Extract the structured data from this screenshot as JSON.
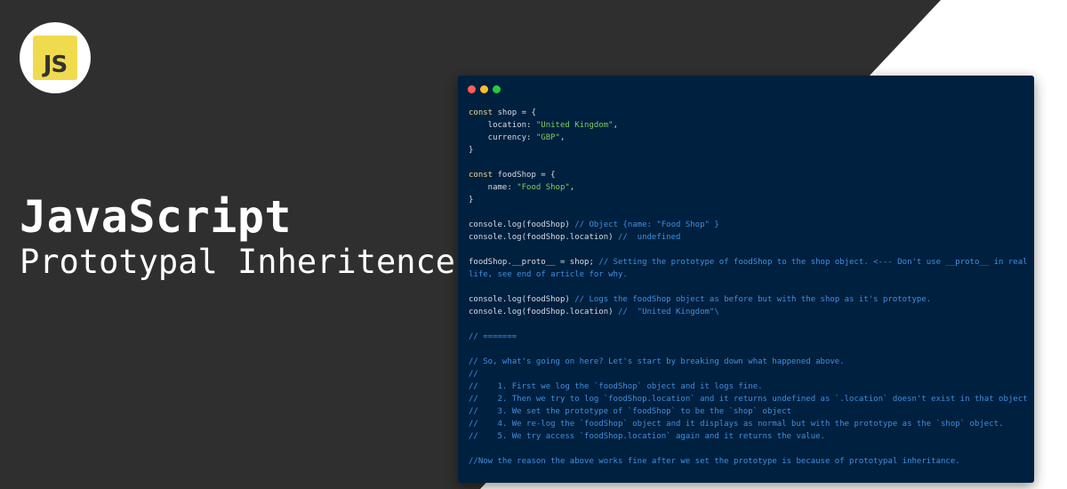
{
  "logo": {
    "text": "JS",
    "color": "#f0db4f"
  },
  "title": "JavaScript",
  "subtitle": "Prototypal Inheritence",
  "window": {
    "dot_colors": [
      "#ff5f56",
      "#ffbd2e",
      "#27c93f"
    ]
  },
  "theme": {
    "background_dark": "#2f2f2f",
    "background_light": "#ffffff",
    "code_bg": "#00203f",
    "code_text": "#d5dde6",
    "keyword": "#f0d98c",
    "string": "#7ccf5a",
    "comment": "#3f8fe0"
  },
  "code_lines": [
    [
      {
        "t": "const",
        "k": "keyword"
      },
      {
        "t": " shop = {",
        "k": "plain"
      }
    ],
    [
      {
        "t": "    location: ",
        "k": "plain"
      },
      {
        "t": "\"United Kingdom\"",
        "k": "string"
      },
      {
        "t": ",",
        "k": "plain"
      }
    ],
    [
      {
        "t": "    currency: ",
        "k": "plain"
      },
      {
        "t": "\"GBP\"",
        "k": "string"
      },
      {
        "t": ",",
        "k": "plain"
      }
    ],
    [
      {
        "t": "}",
        "k": "plain"
      }
    ],
    [],
    [
      {
        "t": "const",
        "k": "keyword"
      },
      {
        "t": " foodShop = {",
        "k": "plain"
      }
    ],
    [
      {
        "t": "    name: ",
        "k": "plain"
      },
      {
        "t": "\"Food Shop\"",
        "k": "string"
      },
      {
        "t": ",",
        "k": "plain"
      }
    ],
    [
      {
        "t": "}",
        "k": "plain"
      }
    ],
    [],
    [
      {
        "t": "console.log(foodShop) ",
        "k": "plain"
      },
      {
        "t": "// Object {name: \"Food Shop\" }",
        "k": "comment"
      }
    ],
    [
      {
        "t": "console.log(foodShop.location) ",
        "k": "plain"
      },
      {
        "t": "//  undefined",
        "k": "comment"
      }
    ],
    [],
    [
      {
        "t": "foodShop.__proto__ = shop; ",
        "k": "plain"
      },
      {
        "t": "// Setting the prototype of foodShop to the shop object. <--- Don't use __proto__ in real",
        "k": "comment"
      }
    ],
    [
      {
        "t": "life, see end of article for why.",
        "k": "comment"
      }
    ],
    [],
    [
      {
        "t": "console.log(foodShop) ",
        "k": "plain"
      },
      {
        "t": "// Logs the foodShop object as before but with the shop as it's prototype.",
        "k": "comment"
      }
    ],
    [
      {
        "t": "console.log(foodShop.location) ",
        "k": "plain"
      },
      {
        "t": "//  \"United Kingdom\"\\",
        "k": "comment"
      }
    ],
    [],
    [
      {
        "t": "// =======",
        "k": "comment"
      }
    ],
    [],
    [
      {
        "t": "// So, what's going on here? Let's start by breaking down what happened above.",
        "k": "comment"
      }
    ],
    [
      {
        "t": "//",
        "k": "comment"
      }
    ],
    [
      {
        "t": "//    1. First we log the `foodShop` object and it logs fine.",
        "k": "comment"
      }
    ],
    [
      {
        "t": "//    2. Then we try to log `foodShop.location` and it returns undefined as `.location` doesn't exist in that object",
        "k": "comment"
      }
    ],
    [
      {
        "t": "//    3. We set the prototype of `foodShop` to be the `shop` object",
        "k": "comment"
      }
    ],
    [
      {
        "t": "//    4. We re-log the `foodShop` object and it displays as normal but with the prototype as the `shop` object.",
        "k": "comment"
      }
    ],
    [
      {
        "t": "//    5. We try access `foodShop.location` again and it returns the value.",
        "k": "comment"
      }
    ],
    [],
    [
      {
        "t": "//Now the reason the above works fine after we set the prototype is because of prototypal inheritance.",
        "k": "comment"
      }
    ]
  ]
}
